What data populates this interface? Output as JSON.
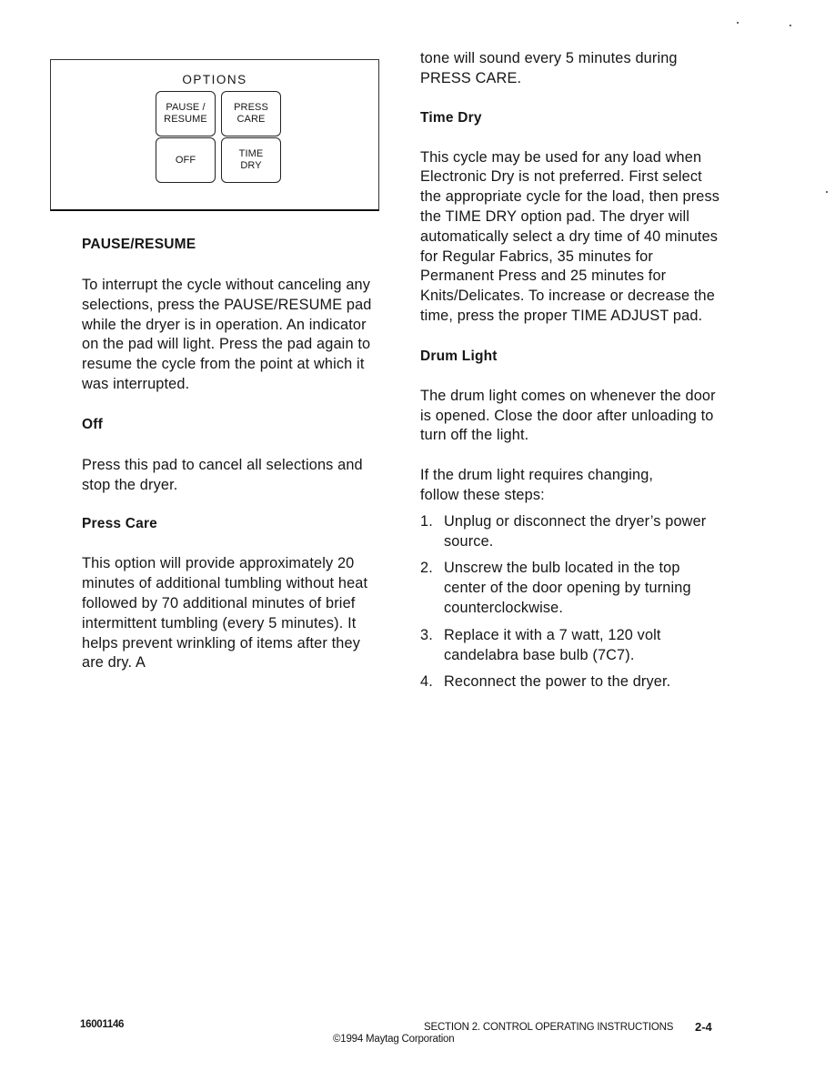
{
  "options_panel": {
    "title": "OPTIONS",
    "pads": [
      {
        "line1": "PAUSE /",
        "line2": "RESUME"
      },
      {
        "line1": "PRESS",
        "line2": "CARE"
      },
      {
        "line1": "OFF",
        "line2": ""
      },
      {
        "line1": "TIME",
        "line2": "DRY"
      }
    ]
  },
  "left_column": {
    "pause_resume": {
      "heading": "PAUSE/RESUME",
      "text": "To interrupt the cycle without canceling any selections, press the PAUSE/RESUME pad while the dryer is in operation.  An indicator on the pad will light.  Press the pad again to resume the cycle from the point at which it was interrupted."
    },
    "off": {
      "heading": "Off",
      "text": "Press this pad to cancel all selections and stop the dryer."
    },
    "press_care": {
      "heading": "Press Care",
      "text": "This option will provide approximately 20 minutes of additional tumbling without heat followed by 70 additional minutes of brief intermittent tumbling (every 5 minutes).  It helps prevent wrinkling of items after they are dry.  A"
    }
  },
  "right_column": {
    "continued_text": "tone will sound every 5 minutes during PRESS CARE.",
    "time_dry": {
      "heading": "Time Dry",
      "text": "This cycle may be used for any load when Electronic Dry is not preferred. First select the appropriate cycle for the load, then press the TIME DRY option pad.  The dryer will automatically select a dry time of 40 minutes for Regular Fabrics, 35 minutes for Permanent Press and 25 minutes for Knits/Delicates.  To increase or decrease the time, press the proper TIME ADJUST pad."
    },
    "drum_light": {
      "heading": "Drum Light",
      "text": "The drum light comes on whenever the door is opened.  Close the door after unloading to turn off the light.",
      "steps_intro": "If the drum light requires changing, follow these steps:",
      "steps": [
        {
          "num": "1.",
          "text": "Unplug or disconnect the dryer’s power source."
        },
        {
          "num": "2.",
          "text": "Unscrew the bulb located in the top center of the door opening by turning counterclockwise."
        },
        {
          "num": "3.",
          "text": "Replace it with a 7 watt, 120 volt candelabra base bulb (7C7)."
        },
        {
          "num": "4.",
          "text": "Reconnect the power to the dryer."
        }
      ]
    }
  },
  "footer": {
    "doc_number": "16001146",
    "section": "SECTION 2.  CONTROL OPERATING INSTRUCTIONS",
    "page": "2-4",
    "copyright": "©1994 Maytag Corporation"
  }
}
